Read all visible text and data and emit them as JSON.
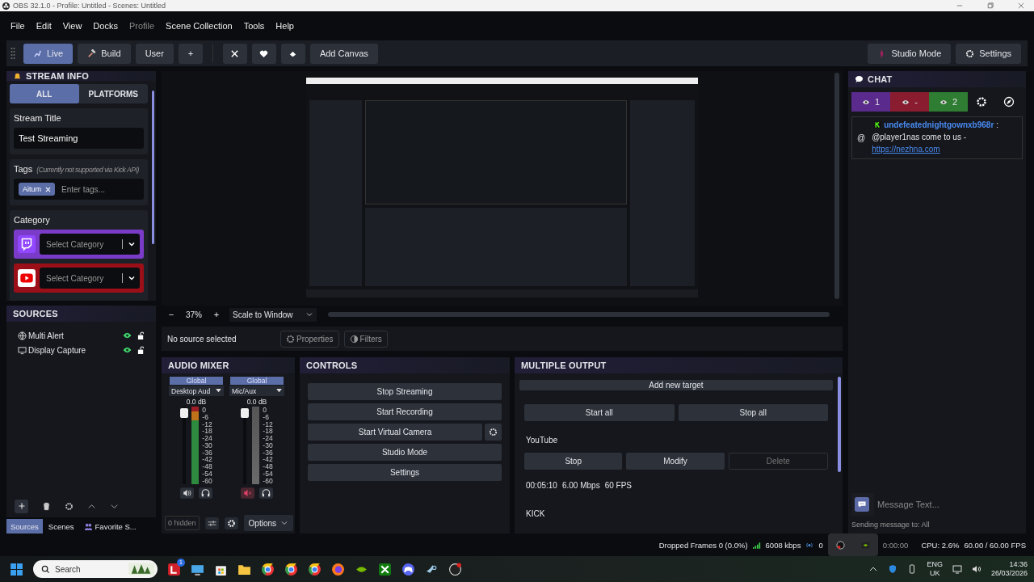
{
  "window": {
    "title": "OBS 32.1.0 - Profile: Untitled - Scenes: Untitled"
  },
  "menu": [
    {
      "label": "File",
      "disabled": false
    },
    {
      "label": "Edit",
      "disabled": false
    },
    {
      "label": "View",
      "disabled": false
    },
    {
      "label": "Docks",
      "disabled": false
    },
    {
      "label": "Profile",
      "disabled": true
    },
    {
      "label": "Scene Collection",
      "disabled": false
    },
    {
      "label": "Tools",
      "disabled": false
    },
    {
      "label": "Help",
      "disabled": false
    }
  ],
  "toolbar": {
    "modes": [
      {
        "label": "Live",
        "kind": "live",
        "selected": true
      },
      {
        "label": "Build",
        "kind": "build",
        "selected": false
      },
      {
        "label": "User",
        "kind": "plain",
        "selected": false
      }
    ],
    "add": "+",
    "add_canvas": "Add Canvas",
    "studio_mode": "Studio Mode",
    "settings": "Settings"
  },
  "stream_info": {
    "title": "STREAM INFO",
    "tabs": [
      {
        "label": "ALL",
        "selected": true
      },
      {
        "label": "PLATFORMS",
        "selected": false
      }
    ],
    "stream_title_label": "Stream Title",
    "stream_title": "Test Streaming",
    "tags_label": "Tags",
    "tags_note": "(Currently not supported via Kick API)",
    "tags": [
      "Aitum"
    ],
    "tags_placeholder": "Enter tags...",
    "category_label": "Category",
    "categories": [
      {
        "kind": "twitch",
        "placeholder": "Select Category",
        "color": "#7a3cc8"
      },
      {
        "kind": "youtube",
        "placeholder": "Select Category",
        "color": "#9b1018"
      }
    ]
  },
  "sources": {
    "title": "SOURCES",
    "items": [
      {
        "name": "Multi Alert",
        "kind": "browser",
        "visible": true,
        "locked": false
      },
      {
        "name": "Display Capture",
        "kind": "display",
        "visible": true,
        "locked": false
      }
    ],
    "tabs": [
      {
        "label": "Sources",
        "kind": "plain",
        "selected": true
      },
      {
        "label": "Scenes",
        "kind": "plain",
        "selected": false
      },
      {
        "label": "Favorite S...",
        "kind": "favorites",
        "selected": false
      }
    ]
  },
  "preview": {
    "zoom_out": "−",
    "zoom": "37%",
    "zoom_in": "+",
    "scale": "Scale to Window"
  },
  "source_bar": {
    "status": "No source selected",
    "properties": "Properties",
    "filters": "Filters"
  },
  "audio_mixer": {
    "title": "AUDIO MIXER",
    "channels": [
      {
        "group": "Global",
        "name": "Desktop Aud",
        "db": "0.0 dB",
        "level": 0.97,
        "muted": false,
        "scale": [
          "0",
          "-6",
          "-12",
          "-18",
          "-24",
          "-30",
          "-36",
          "-42",
          "-48",
          "-54",
          "-60"
        ]
      },
      {
        "group": "Global",
        "name": "Mic/Aux",
        "db": "0.0 dB",
        "level": 0.97,
        "muted": true,
        "scale": [
          "0",
          "-6",
          "-12",
          "-18",
          "-24",
          "-30",
          "-36",
          "-42",
          "-48",
          "-54",
          "-60"
        ]
      }
    ],
    "hidden": "0 hidden",
    "options": "Options"
  },
  "controls": {
    "title": "CONTROLS",
    "buttons": [
      {
        "label": "Stop Streaming",
        "kind": "plain"
      },
      {
        "label": "Start Recording",
        "kind": "plain"
      },
      {
        "label": "Start Virtual Camera",
        "kind": "with-settings"
      },
      {
        "label": "Studio Mode",
        "kind": "plain"
      },
      {
        "label": "Settings",
        "kind": "plain"
      }
    ]
  },
  "multiple_output": {
    "title": "MULTIPLE OUTPUT",
    "add": "Add new target",
    "start_all": "Start all",
    "stop_all": "Stop all",
    "targets": [
      {
        "name": "YouTube",
        "buttons": [
          {
            "label": "Stop",
            "disabled": false
          },
          {
            "label": "Modify",
            "disabled": false
          },
          {
            "label": "Delete",
            "disabled": true
          }
        ],
        "stats": [
          "00:05:10",
          "6.00 Mbps",
          "60 FPS"
        ]
      },
      {
        "name": "KICK"
      }
    ]
  },
  "chat": {
    "title": "CHAT",
    "counters": [
      {
        "value": "1",
        "color": "#5a2a8c"
      },
      {
        "value": "-",
        "color": "#8a1c30"
      },
      {
        "value": "2",
        "color": "#2f7d32"
      }
    ],
    "messages": [
      {
        "mention": "@",
        "user": "undefeatednightgownxb968r",
        "separator": ":",
        "text": "@player1nas come to us - ",
        "link": "https://nezhna.com"
      }
    ],
    "input_placeholder": "Message Text...",
    "sending": "Sending message to: All"
  },
  "status_bar": {
    "dropped": "Dropped Frames 0 (0.0%)",
    "bitrate": "6008 kbps",
    "partial": "0",
    "time": "0:00:00",
    "cpu": "CPU: 2.6%",
    "fps": "60.00 / 60.00 FPS"
  },
  "taskbar": {
    "search": "Search",
    "badge": "1",
    "lang": "ENG",
    "region": "UK",
    "time": "14:36",
    "date": "26/03/2026"
  }
}
